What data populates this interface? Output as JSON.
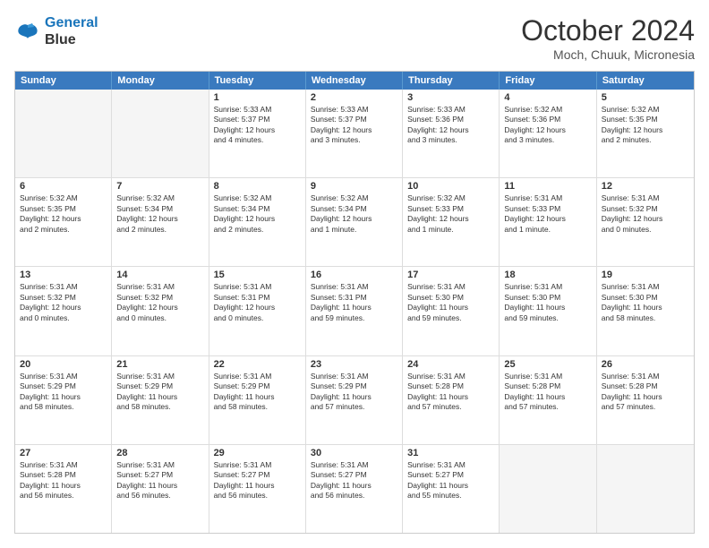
{
  "logo": {
    "line1": "General",
    "line2": "Blue"
  },
  "title": "October 2024",
  "location": "Moch, Chuuk, Micronesia",
  "header": {
    "days": [
      "Sunday",
      "Monday",
      "Tuesday",
      "Wednesday",
      "Thursday",
      "Friday",
      "Saturday"
    ]
  },
  "rows": [
    [
      {
        "day": "",
        "text": "",
        "empty": true
      },
      {
        "day": "",
        "text": "",
        "empty": true
      },
      {
        "day": "1",
        "text": "Sunrise: 5:33 AM\nSunset: 5:37 PM\nDaylight: 12 hours\nand 4 minutes."
      },
      {
        "day": "2",
        "text": "Sunrise: 5:33 AM\nSunset: 5:37 PM\nDaylight: 12 hours\nand 3 minutes."
      },
      {
        "day": "3",
        "text": "Sunrise: 5:33 AM\nSunset: 5:36 PM\nDaylight: 12 hours\nand 3 minutes."
      },
      {
        "day": "4",
        "text": "Sunrise: 5:32 AM\nSunset: 5:36 PM\nDaylight: 12 hours\nand 3 minutes."
      },
      {
        "day": "5",
        "text": "Sunrise: 5:32 AM\nSunset: 5:35 PM\nDaylight: 12 hours\nand 2 minutes."
      }
    ],
    [
      {
        "day": "6",
        "text": "Sunrise: 5:32 AM\nSunset: 5:35 PM\nDaylight: 12 hours\nand 2 minutes."
      },
      {
        "day": "7",
        "text": "Sunrise: 5:32 AM\nSunset: 5:34 PM\nDaylight: 12 hours\nand 2 minutes."
      },
      {
        "day": "8",
        "text": "Sunrise: 5:32 AM\nSunset: 5:34 PM\nDaylight: 12 hours\nand 2 minutes."
      },
      {
        "day": "9",
        "text": "Sunrise: 5:32 AM\nSunset: 5:34 PM\nDaylight: 12 hours\nand 1 minute."
      },
      {
        "day": "10",
        "text": "Sunrise: 5:32 AM\nSunset: 5:33 PM\nDaylight: 12 hours\nand 1 minute."
      },
      {
        "day": "11",
        "text": "Sunrise: 5:31 AM\nSunset: 5:33 PM\nDaylight: 12 hours\nand 1 minute."
      },
      {
        "day": "12",
        "text": "Sunrise: 5:31 AM\nSunset: 5:32 PM\nDaylight: 12 hours\nand 0 minutes."
      }
    ],
    [
      {
        "day": "13",
        "text": "Sunrise: 5:31 AM\nSunset: 5:32 PM\nDaylight: 12 hours\nand 0 minutes."
      },
      {
        "day": "14",
        "text": "Sunrise: 5:31 AM\nSunset: 5:32 PM\nDaylight: 12 hours\nand 0 minutes."
      },
      {
        "day": "15",
        "text": "Sunrise: 5:31 AM\nSunset: 5:31 PM\nDaylight: 12 hours\nand 0 minutes."
      },
      {
        "day": "16",
        "text": "Sunrise: 5:31 AM\nSunset: 5:31 PM\nDaylight: 11 hours\nand 59 minutes."
      },
      {
        "day": "17",
        "text": "Sunrise: 5:31 AM\nSunset: 5:30 PM\nDaylight: 11 hours\nand 59 minutes."
      },
      {
        "day": "18",
        "text": "Sunrise: 5:31 AM\nSunset: 5:30 PM\nDaylight: 11 hours\nand 59 minutes."
      },
      {
        "day": "19",
        "text": "Sunrise: 5:31 AM\nSunset: 5:30 PM\nDaylight: 11 hours\nand 58 minutes."
      }
    ],
    [
      {
        "day": "20",
        "text": "Sunrise: 5:31 AM\nSunset: 5:29 PM\nDaylight: 11 hours\nand 58 minutes."
      },
      {
        "day": "21",
        "text": "Sunrise: 5:31 AM\nSunset: 5:29 PM\nDaylight: 11 hours\nand 58 minutes."
      },
      {
        "day": "22",
        "text": "Sunrise: 5:31 AM\nSunset: 5:29 PM\nDaylight: 11 hours\nand 58 minutes."
      },
      {
        "day": "23",
        "text": "Sunrise: 5:31 AM\nSunset: 5:29 PM\nDaylight: 11 hours\nand 57 minutes."
      },
      {
        "day": "24",
        "text": "Sunrise: 5:31 AM\nSunset: 5:28 PM\nDaylight: 11 hours\nand 57 minutes."
      },
      {
        "day": "25",
        "text": "Sunrise: 5:31 AM\nSunset: 5:28 PM\nDaylight: 11 hours\nand 57 minutes."
      },
      {
        "day": "26",
        "text": "Sunrise: 5:31 AM\nSunset: 5:28 PM\nDaylight: 11 hours\nand 57 minutes."
      }
    ],
    [
      {
        "day": "27",
        "text": "Sunrise: 5:31 AM\nSunset: 5:28 PM\nDaylight: 11 hours\nand 56 minutes."
      },
      {
        "day": "28",
        "text": "Sunrise: 5:31 AM\nSunset: 5:27 PM\nDaylight: 11 hours\nand 56 minutes."
      },
      {
        "day": "29",
        "text": "Sunrise: 5:31 AM\nSunset: 5:27 PM\nDaylight: 11 hours\nand 56 minutes."
      },
      {
        "day": "30",
        "text": "Sunrise: 5:31 AM\nSunset: 5:27 PM\nDaylight: 11 hours\nand 56 minutes."
      },
      {
        "day": "31",
        "text": "Sunrise: 5:31 AM\nSunset: 5:27 PM\nDaylight: 11 hours\nand 55 minutes."
      },
      {
        "day": "",
        "text": "",
        "empty": true
      },
      {
        "day": "",
        "text": "",
        "empty": true
      }
    ]
  ]
}
